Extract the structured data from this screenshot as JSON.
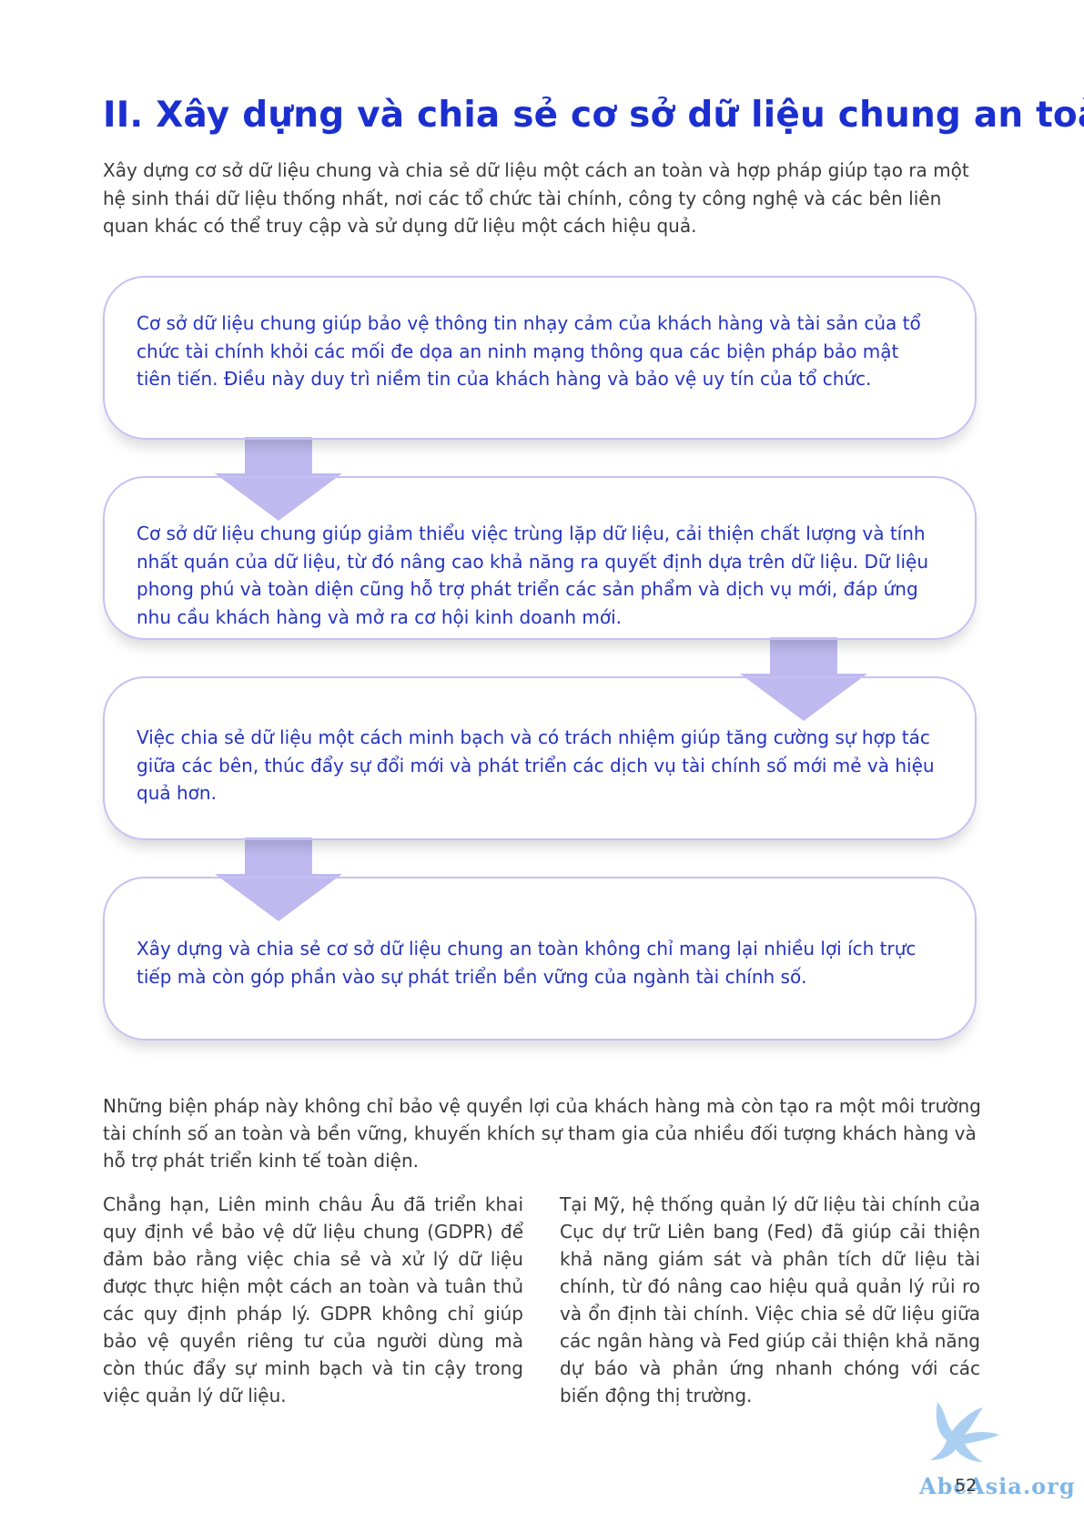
{
  "heading": "II. Xây dựng và chia sẻ cơ sở dữ liệu chung an toàn",
  "intro": "Xây dựng cơ sở dữ liệu chung và chia sẻ dữ liệu một cách an toàn và hợp pháp giúp tạo ra một hệ sinh thái dữ liệu thống nhất, nơi các tổ chức tài chính, công ty công nghệ và các bên liên quan khác có thể truy cập và sử dụng dữ liệu một cách hiệu quả.",
  "flow": [
    {
      "text": "Cơ sở dữ liệu chung giúp bảo vệ thông tin nhạy cảm của khách hàng và tài sản của tổ chức tài chính khỏi các mối đe dọa an ninh mạng thông qua các biện pháp bảo mật tiên tiến. Điều này duy trì niềm tin của khách hàng và bảo vệ uy tín của tổ chức."
    },
    {
      "text": "Cơ sở dữ liệu chung giúp giảm thiểu việc trùng lặp dữ liệu, cải thiện chất lượng và tính nhất quán của dữ liệu, từ đó nâng cao khả năng ra quyết định dựa trên dữ liệu. Dữ liệu phong phú và toàn diện cũng hỗ trợ phát triển các sản phẩm và dịch vụ mới, đáp ứng nhu cầu khách hàng và mở ra cơ hội kinh doanh mới."
    },
    {
      "text": "Việc chia sẻ dữ liệu một cách minh bạch và có trách nhiệm giúp tăng cường sự hợp tác giữa các bên, thúc đẩy sự đổi mới và phát triển các dịch vụ tài chính số mới mẻ và hiệu quả hơn."
    },
    {
      "text": "Xây dựng và chia sẻ cơ sở dữ liệu chung an toàn không chỉ mang lại nhiều lợi ích trực tiếp mà còn góp phần vào sự phát triển bền vững của ngành tài chính số."
    }
  ],
  "summary": "Những biện pháp này không chỉ bảo vệ quyền lợi của khách hàng mà còn tạo ra một môi trường tài chính số an toàn và bền vững, khuyến khích sự tham gia của nhiều đối tượng khách hàng và hỗ trợ phát triển kinh tế toàn diện.",
  "col_left": "Chẳng hạn, Liên minh châu Âu đã triển khai quy định về bảo vệ dữ liệu chung (GDPR) để đảm bảo rằng việc chia sẻ và xử lý dữ liệu được thực hiện một cách an toàn và tuân thủ các quy định pháp lý. GDPR không chỉ giúp bảo vệ quyền riêng tư của người dùng mà còn thúc đẩy sự minh bạch và tin cậy trong việc quản lý dữ liệu.",
  "col_right": "Tại Mỹ, hệ thống quản lý dữ liệu tài chính của Cục dự trữ Liên bang (Fed) đã giúp cải thiện khả năng giám sát và phân tích dữ liệu tài chính, từ đó nâng cao hiệu quả quản lý rủi ro và ổn định tài chính. Việc chia sẻ dữ liệu giữa các ngân hàng và Fed giúp cải thiện khả năng dự báo và phản ứng nhanh chóng với các biến động thị trường.",
  "page_number": "52",
  "watermark": "AbcAsia.org",
  "colors": {
    "heading": "#1b2fd0",
    "box_text": "#2433c0",
    "box_border": "#c5c1f3",
    "arrow": "#c0b9f0"
  }
}
